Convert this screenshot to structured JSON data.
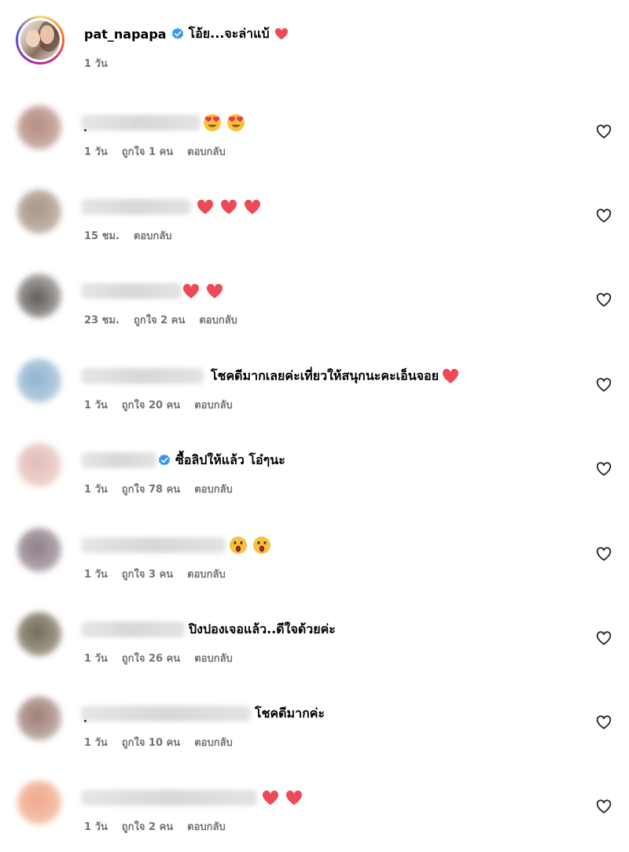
{
  "post": {
    "username": "pat_napapa",
    "caption": "โอ้ย...จะล่าแบ้",
    "time": "1 วัน"
  },
  "colors": {
    "verified": "#3897f0",
    "heart": "#ed4956",
    "meta": "#737373"
  },
  "comments": [
    {
      "text": "",
      "emoji": "heart-eyes-emoji",
      "emoji_count": 2,
      "time": "1 วัน",
      "likes": "ถูกใจ 1 คน",
      "reply": "ตอบกลับ"
    },
    {
      "text": "",
      "emoji": "red-heart-emoji",
      "emoji_count": 3,
      "time": "15 ชม.",
      "likes": "",
      "reply": "ตอบกลับ"
    },
    {
      "text": "",
      "emoji": "red-heart-emoji",
      "emoji_count": 2,
      "time": "23 ชม.",
      "likes": "ถูกใจ 2 คน",
      "reply": "ตอบกลับ"
    },
    {
      "text": "โชคดีมากเลยค่ะเที่ยวให้สนุกนะคะเอ็นจอย",
      "emoji": "red-heart-emoji",
      "emoji_count": 1,
      "time": "1 วัน",
      "likes": "ถูกใจ 20 คน",
      "reply": "ตอบกลับ"
    },
    {
      "text": "ซื้อลิปให้แล้ว โอ๋ๆนะ",
      "emoji": "",
      "emoji_count": 0,
      "time": "1 วัน",
      "likes": "ถูกใจ 78 คน",
      "reply": "ตอบกลับ",
      "verified": true
    },
    {
      "text": "",
      "emoji": "astonished-face-emoji",
      "emoji_count": 2,
      "time": "1 วัน",
      "likes": "ถูกใจ 3 คน",
      "reply": "ตอบกลับ"
    },
    {
      "text": "ปิงปองเจอแล้ว..ดีใจด้วยค่ะ",
      "emoji": "",
      "emoji_count": 0,
      "time": "1 วัน",
      "likes": "ถูกใจ 26 คน",
      "reply": "ตอบกลับ"
    },
    {
      "text": "โชคดีมากค่ะ",
      "emoji": "",
      "emoji_count": 0,
      "time": "1 วัน",
      "likes": "ถูกใจ 10 คน",
      "reply": "ตอบกลับ"
    },
    {
      "text": "",
      "emoji": "red-heart-emoji",
      "emoji_count": 2,
      "time": "1 วัน",
      "likes": "ถูกใจ 2 คน",
      "reply": "ตอบกลับ"
    }
  ]
}
